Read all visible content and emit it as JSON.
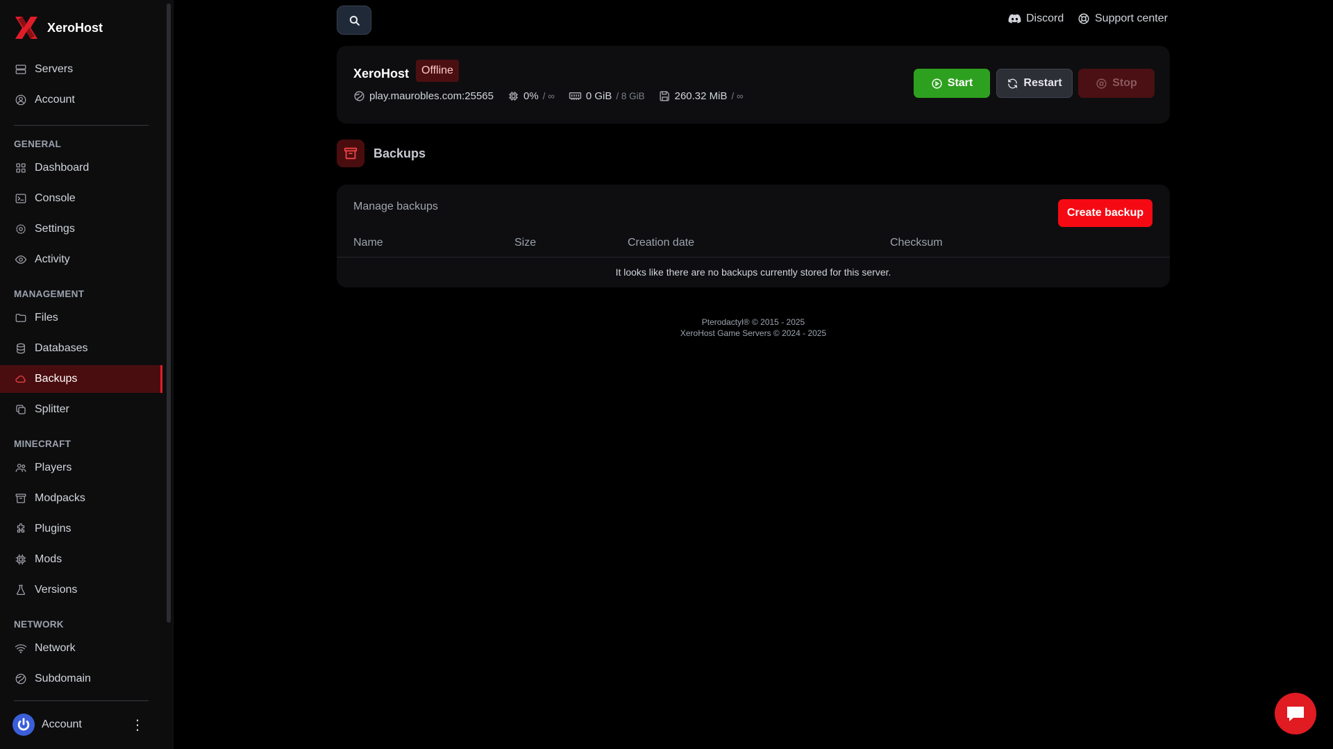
{
  "brand": {
    "name": "XeroHost"
  },
  "sidebar": {
    "top_items": [
      {
        "label": "Servers",
        "icon": "server-icon"
      },
      {
        "label": "Account",
        "icon": "user-circle-icon"
      }
    ],
    "sections": {
      "general": "GENERAL",
      "management": "MANAGEMENT",
      "minecraft": "MINECRAFT",
      "network": "NETWORK"
    },
    "general_items": [
      {
        "label": "Dashboard"
      },
      {
        "label": "Console"
      },
      {
        "label": "Settings"
      },
      {
        "label": "Activity"
      }
    ],
    "management_items": [
      {
        "label": "Files"
      },
      {
        "label": "Databases"
      },
      {
        "label": "Backups"
      },
      {
        "label": "Splitter"
      }
    ],
    "minecraft_items": [
      {
        "label": "Players"
      },
      {
        "label": "Modpacks"
      },
      {
        "label": "Plugins"
      },
      {
        "label": "Mods"
      },
      {
        "label": "Versions"
      }
    ],
    "network_items": [
      {
        "label": "Network"
      },
      {
        "label": "Subdomain"
      }
    ],
    "active_item": "Backups",
    "account_label": "Account",
    "kebab": "⋮"
  },
  "topbar": {
    "discord": "Discord",
    "support": "Support center"
  },
  "server": {
    "name": "XeroHost",
    "status": "Offline",
    "address": "play.maurobles.com:25565",
    "cpu": "0%",
    "cpu_limit": "/ ∞",
    "memory": "0 GiB",
    "memory_limit": "/ 8 GiB",
    "disk": "260.32 MiB",
    "disk_limit": "/ ∞",
    "buttons": {
      "start": "Start",
      "restart": "Restart",
      "stop": "Stop"
    }
  },
  "backups": {
    "title": "Backups",
    "manage": "Manage backups",
    "create": "Create backup",
    "columns": [
      "Name",
      "Size",
      "Creation date",
      "Checksum"
    ],
    "empty": "It looks like there are no backups currently stored for this server."
  },
  "footer": {
    "line1": "Pterodactyl® © 2015 - 2025",
    "line2": "XeroHost Game Servers © 2024 - 2025"
  },
  "colors": {
    "accent": "#f50a14",
    "start": "#2ea01f",
    "active_bg": "#4a0d0f"
  }
}
